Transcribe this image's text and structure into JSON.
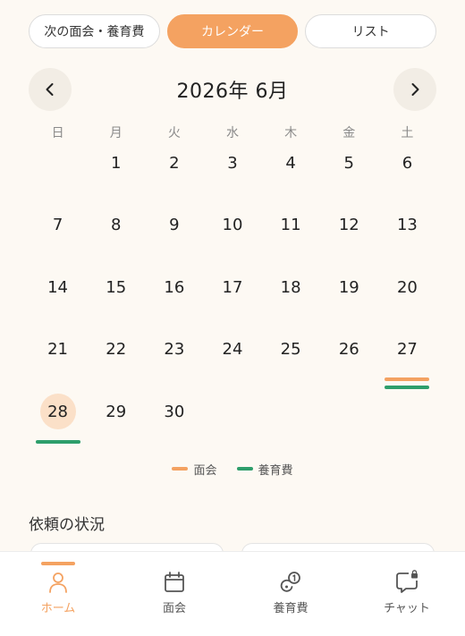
{
  "segments": [
    {
      "label": "次の面会・養育費",
      "active": false
    },
    {
      "label": "カレンダー",
      "active": true
    },
    {
      "label": "リスト",
      "active": false
    }
  ],
  "calendar": {
    "month_title": "2026年 6月",
    "weekdays": [
      "日",
      "月",
      "火",
      "水",
      "木",
      "金",
      "土"
    ],
    "leading_blanks": 1,
    "days": 30,
    "today": 28,
    "visit_days": [
      27
    ],
    "support_days": [
      27,
      28
    ]
  },
  "legend": {
    "visit": "面会",
    "support": "養育費"
  },
  "colors": {
    "accent": "#f4a261",
    "support": "#2e9e6b",
    "today_bg": "#fbe0c8"
  },
  "section": {
    "title": "依頼の状況"
  },
  "tabs": [
    {
      "label": "ホーム",
      "icon": "person-icon",
      "active": true
    },
    {
      "label": "面会",
      "icon": "calendar-icon",
      "active": false
    },
    {
      "label": "養育費",
      "icon": "coins-icon",
      "active": false
    },
    {
      "label": "チャット",
      "icon": "chat-lock-icon",
      "active": false
    }
  ]
}
